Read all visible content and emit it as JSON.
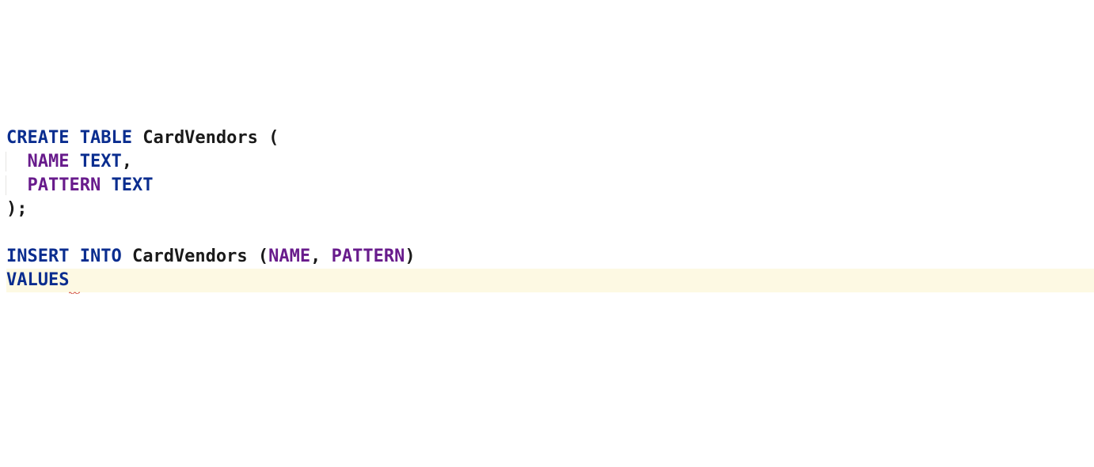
{
  "code": {
    "lines": [
      {
        "tokens": [
          {
            "text": "CREATE TABLE",
            "class": "kw-blue"
          },
          {
            "text": " ",
            "class": "plain"
          },
          {
            "text": "CardVendors",
            "class": "plain"
          },
          {
            "text": " (",
            "class": "paren"
          }
        ]
      },
      {
        "indent": true,
        "tokens": [
          {
            "text": "NAME",
            "class": "kw-purple"
          },
          {
            "text": " ",
            "class": "plain"
          },
          {
            "text": "TEXT",
            "class": "kw-blue"
          },
          {
            "text": ",",
            "class": "plain"
          }
        ]
      },
      {
        "indent": true,
        "tokens": [
          {
            "text": "PATTERN",
            "class": "kw-purple"
          },
          {
            "text": " ",
            "class": "plain"
          },
          {
            "text": "TEXT",
            "class": "kw-blue"
          }
        ]
      },
      {
        "tokens": [
          {
            "text": ");",
            "class": "plain"
          }
        ]
      },
      {
        "tokens": []
      },
      {
        "tokens": [
          {
            "text": "INSERT INTO",
            "class": "kw-blue"
          },
          {
            "text": " ",
            "class": "plain"
          },
          {
            "text": "CardVendors",
            "class": "plain"
          },
          {
            "text": " (",
            "class": "paren"
          },
          {
            "text": "NAME",
            "class": "kw-purple"
          },
          {
            "text": ", ",
            "class": "plain"
          },
          {
            "text": "PATTERN",
            "class": "kw-purple"
          },
          {
            "text": ")",
            "class": "paren"
          }
        ]
      },
      {
        "highlight": true,
        "tokens": [
          {
            "text": "VALUES",
            "class": "kw-blue"
          },
          {
            "text": " ",
            "class": "plain",
            "error": true
          }
        ]
      }
    ]
  }
}
